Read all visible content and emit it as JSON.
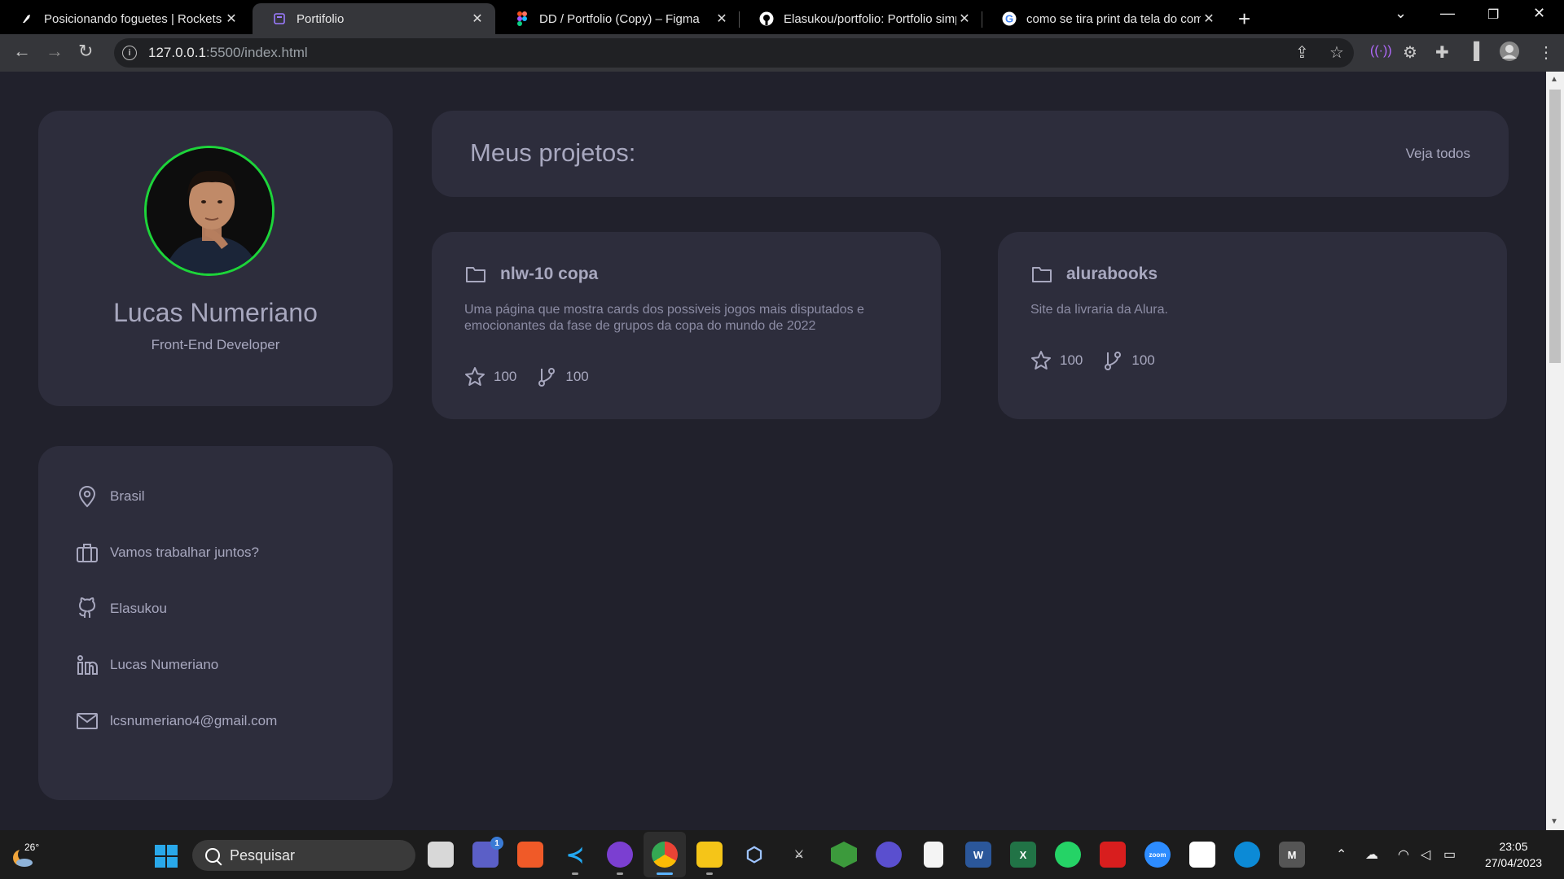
{
  "browser": {
    "tabs": [
      {
        "title": "Posicionando foguetes | Rockets",
        "active": false
      },
      {
        "title": "Portifolio",
        "active": true
      },
      {
        "title": "DD / Portfolio (Copy) – Figma",
        "active": false
      },
      {
        "title": "Elasukou/portfolio: Portfolio simp",
        "active": false
      },
      {
        "title": "como se tira print da tela do com",
        "active": false
      }
    ],
    "url_host": "127.0.0.1",
    "url_path": ":5500/index.html"
  },
  "profile": {
    "name": "Lucas Numeriano",
    "role": "Front-End Developer"
  },
  "contacts": [
    {
      "icon": "location-pin-icon",
      "label": "Brasil"
    },
    {
      "icon": "briefcase-icon",
      "label": "Vamos trabalhar juntos?"
    },
    {
      "icon": "github-icon",
      "label": "Elasukou"
    },
    {
      "icon": "linkedin-icon",
      "label": "Lucas Numeriano"
    },
    {
      "icon": "mail-icon",
      "label": "lcsnumeriano4@gmail.com"
    }
  ],
  "projects_header": {
    "title": "Meus projetos:",
    "see_all": "Veja todos"
  },
  "projects": [
    {
      "name": "nlw-10 copa",
      "description": "Uma página que mostra cards dos possiveis jogos mais disputados e emocionantes da fase de grupos da copa do mundo de 2022",
      "stars": "100",
      "forks": "100"
    },
    {
      "name": "alurabooks",
      "description": "Site da livraria da Alura.",
      "stars": "100",
      "forks": "100"
    }
  ],
  "taskbar": {
    "weather": "26°",
    "search_placeholder": "Pesquisar",
    "badge_count": "1",
    "time": "23:05",
    "date": "27/04/2023"
  },
  "colors": {
    "page_bg": "#21212c",
    "card_bg": "#2d2d3c",
    "text": "#a8a8bf",
    "avatar_ring": "#1dd43a"
  }
}
